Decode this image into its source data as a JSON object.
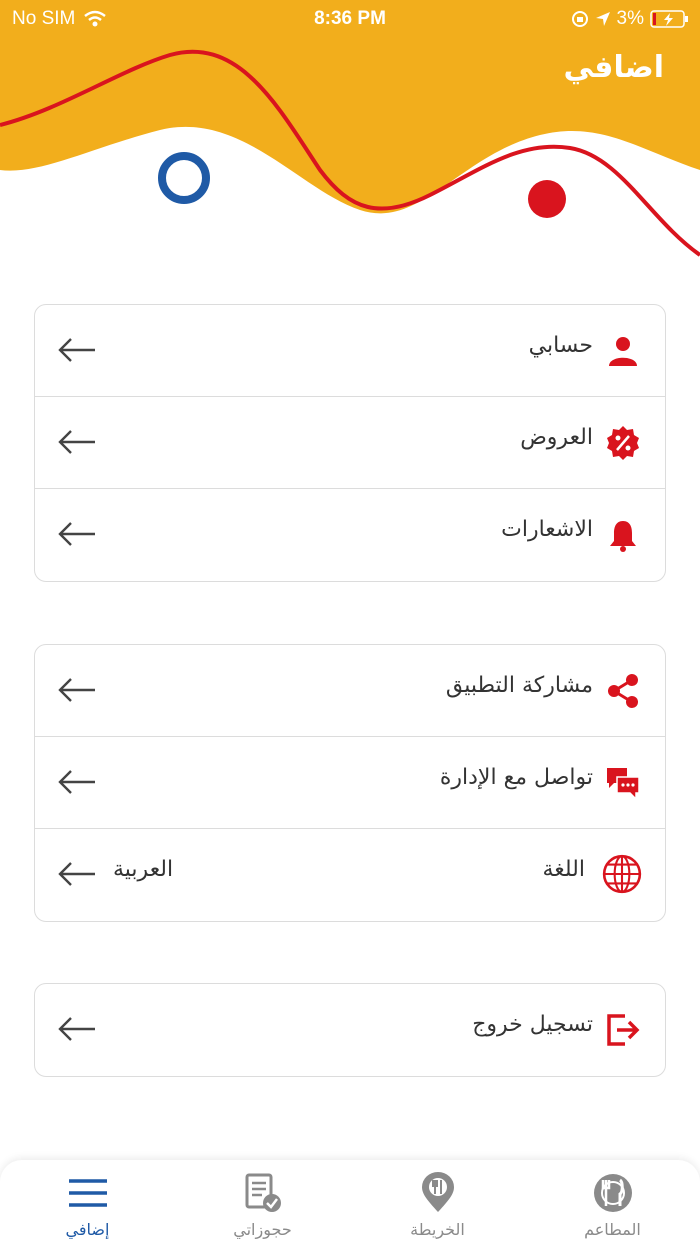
{
  "status_bar": {
    "carrier": "No SIM",
    "time": "8:36 PM",
    "battery": "3%"
  },
  "header": {
    "title": "اضافي"
  },
  "colors": {
    "header_yellow": "#F2AE1C",
    "wave_red": "#D9141E",
    "accent_blue": "#1F5AA6",
    "icon_red": "#D9141E"
  },
  "groups": [
    {
      "items": [
        {
          "label": "حسابي",
          "icon": "user-icon"
        },
        {
          "label": "العروض",
          "icon": "discount-badge-icon"
        },
        {
          "label": "الاشعارات",
          "icon": "bell-icon"
        }
      ]
    },
    {
      "items": [
        {
          "label": "مشاركة التطبيق",
          "icon": "share-icon"
        },
        {
          "label": "تواصل مع الإدارة",
          "icon": "chat-icon"
        },
        {
          "label": "اللغة",
          "icon": "globe-icon",
          "value": "العربية"
        }
      ]
    },
    {
      "items": [
        {
          "label": "تسجيل خروج",
          "icon": "logout-icon"
        }
      ]
    }
  ],
  "tabbar": {
    "tabs": [
      {
        "label": "إضافي",
        "icon": "menu-icon",
        "active": true
      },
      {
        "label": "حجوزاتي",
        "icon": "reservations-icon",
        "active": false
      },
      {
        "label": "الخريطة",
        "icon": "map-pin-icon",
        "active": false
      },
      {
        "label": "المطاعم",
        "icon": "restaurant-icon",
        "active": false
      }
    ]
  }
}
